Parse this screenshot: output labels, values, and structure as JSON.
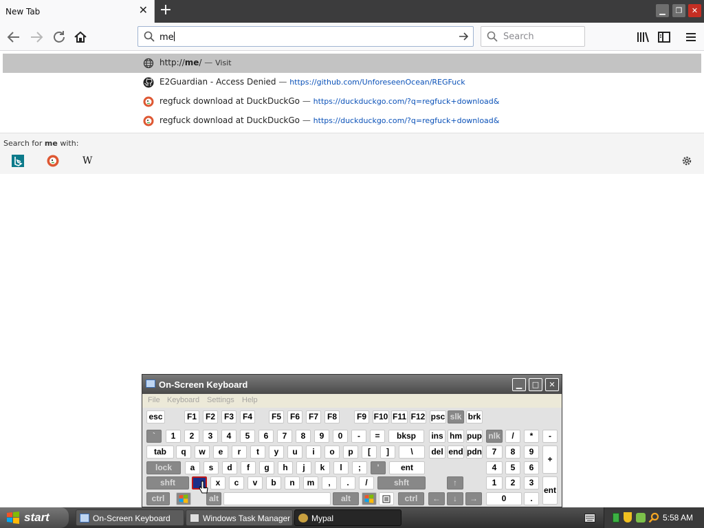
{
  "browser": {
    "tab_title": "New Tab",
    "url_value": "me",
    "search_placeholder": "Search"
  },
  "suggestions": [
    {
      "icon": "globe-icon",
      "url_prefix": "http://",
      "url_bold": "me",
      "url_suffix": "/",
      "action": "Visit"
    },
    {
      "icon": "github-icon",
      "title": "E2Guardian - Access Denied",
      "url": "https://github.com/UnforeseenOcean/REGFuck"
    },
    {
      "icon": "duckduckgo-icon",
      "title": "regfuck download at DuckDuckGo",
      "url": "https://duckduckgo.com/?q=regfuck+download&"
    },
    {
      "icon": "duckduckgo-icon",
      "title": "regfuck download at DuckDuckGo",
      "url": "https://duckduckgo.com/?q=regfuck+download&"
    }
  ],
  "oneoff": {
    "label_prefix": "Search for ",
    "label_term": "me",
    "label_suffix": " with:",
    "engines": [
      "bing-icon",
      "duckduckgo-icon",
      "wikipedia-icon"
    ],
    "wikipedia_glyph": "W"
  },
  "osk": {
    "title": "On-Screen Keyboard",
    "menu": [
      "File",
      "Keyboard",
      "Settings",
      "Help"
    ],
    "rows": {
      "fn": [
        "esc",
        "F1",
        "F2",
        "F3",
        "F4",
        "F5",
        "F6",
        "F7",
        "F8",
        "F9",
        "F10",
        "F11",
        "F12",
        "psc",
        "slk",
        "brk"
      ],
      "num": [
        "`",
        "1",
        "2",
        "3",
        "4",
        "5",
        "6",
        "7",
        "8",
        "9",
        "0",
        "-",
        "=",
        "bksp",
        "ins",
        "hm",
        "pup",
        "nlk",
        "/",
        "*",
        "-"
      ],
      "q": [
        "tab",
        "q",
        "w",
        "e",
        "r",
        "t",
        "y",
        "u",
        "i",
        "o",
        "p",
        "[",
        "]",
        "\\",
        "del",
        "end",
        "pdn",
        "7",
        "8",
        "9",
        "+"
      ],
      "a": [
        "lock",
        "a",
        "s",
        "d",
        "f",
        "g",
        "h",
        "j",
        "k",
        "l",
        ";",
        "'",
        "ent",
        "4",
        "5",
        "6"
      ],
      "z": [
        "shft",
        "z",
        "x",
        "c",
        "v",
        "b",
        "n",
        "m",
        ",",
        ".",
        "/",
        "shft",
        "↑",
        "1",
        "2",
        "3",
        "ent"
      ],
      "ctrl": [
        "ctrl",
        "alt",
        "alt",
        "ctrl",
        "←",
        "↓",
        "→",
        "0",
        "."
      ]
    }
  },
  "taskbar": {
    "start_label": "start",
    "tasks": [
      "On-Screen Keyboard",
      "Windows Task Manager",
      "Mypal"
    ],
    "clock": "5:58 AM"
  }
}
